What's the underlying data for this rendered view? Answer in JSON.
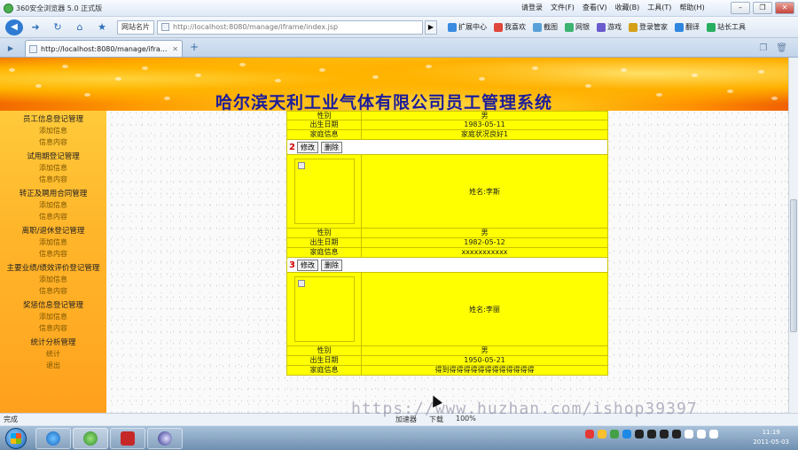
{
  "browser": {
    "title": "360安全浏览器 5.0 正式版",
    "menus": [
      "文件(F)",
      "查看(V)",
      "收藏(B)",
      "工具(T)",
      "帮助(H)"
    ],
    "login_label": "请登录",
    "url": "http://localhost:8080/manage/iframe/index.jsp",
    "site_tag": "网站名片",
    "tools": [
      "扩展中心",
      "我喜欢",
      "截图",
      "网银",
      "游戏",
      "登录管家",
      "翻译",
      "站长工具"
    ],
    "tab_title": "http://localhost:8080/manage/ifra..."
  },
  "page": {
    "system_title": "哈尔滨天利工业气体有限公司员工管理系统",
    "sidebar": [
      {
        "head": "员工信息登记管理",
        "links": [
          "添加信息",
          "信息内容"
        ]
      },
      {
        "head": "试用期登记管理",
        "links": [
          "添加信息",
          "信息内容"
        ]
      },
      {
        "head": "转正及聘用合同管理",
        "links": [
          "添加信息",
          "信息内容"
        ]
      },
      {
        "head": "离职/退休登记管理",
        "links": [
          "添加信息",
          "信息内容"
        ]
      },
      {
        "head": "主要业绩/绩效评价登记管理",
        "links": [
          "添加信息",
          "信息内容"
        ]
      },
      {
        "head": "奖惩信息登记管理",
        "links": [
          "添加信息",
          "信息内容"
        ]
      },
      {
        "head": "统计分析管理",
        "links": [
          "统计"
        ]
      },
      {
        "head": "",
        "links": [
          "退出"
        ]
      }
    ],
    "records": [
      {
        "gender_label": "性别",
        "gender": "男",
        "birth_label": "出生日期",
        "birth": "1983-05-11",
        "family_label": "家庭信息",
        "family": "家庭状况良好1"
      },
      {
        "num": "2",
        "edit": "修改",
        "delete": "删除",
        "name": "姓名:李斯",
        "gender_label": "性别",
        "gender": "男",
        "birth_label": "出生日期",
        "birth": "1982-05-12",
        "family_label": "家庭信息",
        "family": "xxxxxxxxxxx"
      },
      {
        "num": "3",
        "edit": "修改",
        "delete": "删除",
        "name": "姓名:李丽",
        "gender_label": "性别",
        "gender": "男",
        "birth_label": "出生日期",
        "birth": "1950-05-21",
        "family_label": "家庭信息",
        "family": "得到得得得得得得得得得得得得"
      }
    ]
  },
  "status": {
    "text": "完成",
    "items": [
      "加速器",
      "下载",
      "100%"
    ]
  },
  "taskbar": {
    "time": "11:19",
    "date": "2011-05-03"
  },
  "watermark": "https://www.huzhan.com/ishop39397",
  "colors": {
    "row_bg": "#ffff00",
    "title_color": "#1d1d9a",
    "number_color": "#d00000"
  }
}
